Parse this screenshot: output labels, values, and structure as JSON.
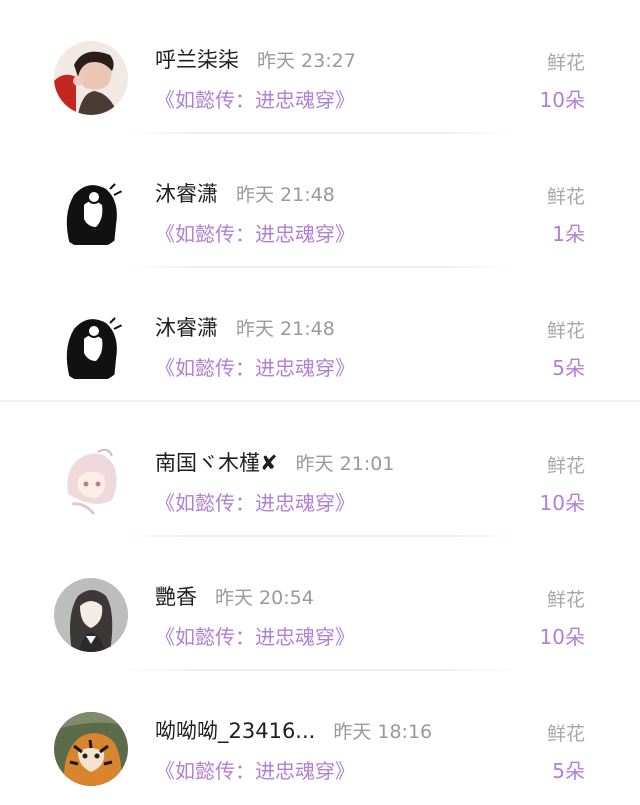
{
  "entries": [
    {
      "username": "呼兰柒柒",
      "time": "昨天 23:27",
      "book": "《如懿传：进忠魂穿》",
      "gift_label": "鲜花",
      "gift_count": "10朵",
      "avatar_icon": "avatar-boy-red"
    },
    {
      "username": "沐睿潇",
      "time": "昨天 21:48",
      "book": "《如懿传：进忠魂穿》",
      "gift_label": "鲜花",
      "gift_count": "1朵",
      "avatar_icon": "avatar-sketch-girl"
    },
    {
      "username": "沐睿潇",
      "time": "昨天 21:48",
      "book": "《如懿传：进忠魂穿》",
      "gift_label": "鲜花",
      "gift_count": "5朵",
      "avatar_icon": "avatar-sketch-girl"
    },
    {
      "username": "南国ヾ木槿✘",
      "time": "昨天 21:01",
      "book": "《如懿传：进忠魂穿》",
      "gift_label": "鲜花",
      "gift_count": "10朵",
      "avatar_icon": "avatar-pink-girl"
    },
    {
      "username": "艷香",
      "time": "昨天 20:54",
      "book": "《如懿传：进忠魂穿》",
      "gift_label": "鲜花",
      "gift_count": "10朵",
      "avatar_icon": "avatar-gray-girl"
    },
    {
      "username": "呦呦呦_23416...",
      "time": "昨天 18:16",
      "book": "《如懿传：进忠魂穿》",
      "gift_label": "鲜花",
      "gift_count": "5朵",
      "avatar_icon": "avatar-tiger"
    }
  ]
}
